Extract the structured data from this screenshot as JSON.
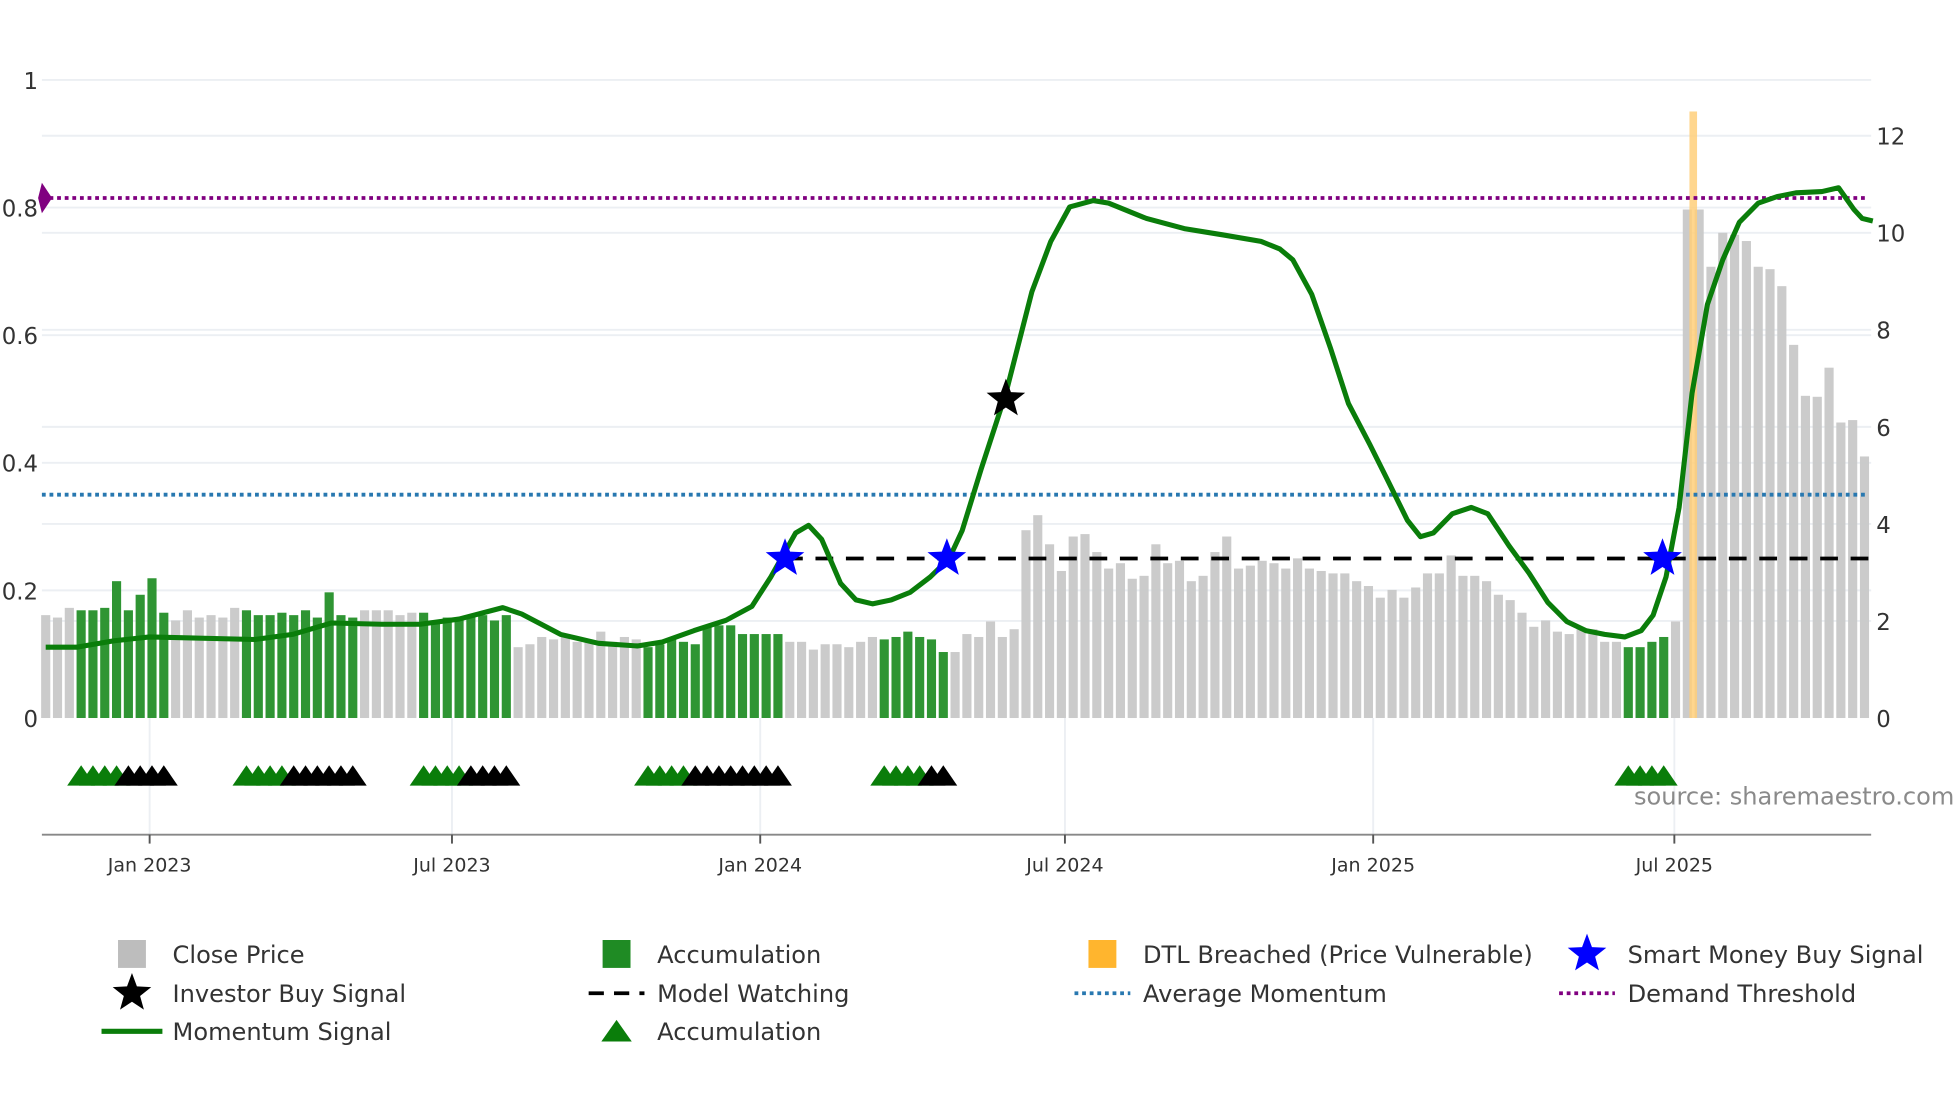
{
  "chart_data": {
    "type": "bar",
    "x_unit": "weeks since first bar (weekly bars)",
    "left_axis": {
      "ylim": [
        0,
        1
      ],
      "ticks": [
        "0",
        "0.2",
        "0.4",
        "0.6",
        "0.8",
        "1"
      ],
      "tick_values": [
        0,
        0.2,
        0.4,
        0.6,
        0.8,
        1
      ]
    },
    "right_axis": {
      "ylim": [
        0,
        13.15
      ],
      "ticks": [
        "0",
        "2",
        "4",
        "6",
        "8",
        "10",
        "12"
      ],
      "tick_values": [
        0,
        2,
        4,
        6,
        8,
        10,
        12
      ]
    },
    "x_ticks": [
      {
        "label": "Jan 2023",
        "x": 8.8
      },
      {
        "label": "Jul 2023",
        "x": 34.4
      },
      {
        "label": "Jan 2024",
        "x": 60.5
      },
      {
        "label": "Jul 2024",
        "x": 86.3
      },
      {
        "label": "Jan 2025",
        "x": 112.4
      },
      {
        "label": "Jul 2025",
        "x": 137.9
      }
    ],
    "close_price": [
      2.12,
      2.07,
      2.27,
      2.22,
      2.22,
      2.27,
      2.82,
      2.22,
      2.54,
      2.88,
      2.17,
      2.01,
      2.22,
      2.07,
      2.12,
      2.07,
      2.27,
      2.22,
      2.12,
      2.12,
      2.17,
      2.12,
      2.22,
      2.07,
      2.59,
      2.12,
      2.07,
      2.22,
      2.22,
      2.22,
      2.12,
      2.17,
      2.17,
      2.01,
      2.07,
      2.07,
      2.12,
      2.12,
      2.01,
      2.12,
      1.46,
      1.52,
      1.67,
      1.62,
      1.67,
      1.57,
      1.62,
      1.78,
      1.57,
      1.67,
      1.62,
      1.46,
      1.52,
      1.62,
      1.57,
      1.52,
      1.88,
      1.91,
      1.91,
      1.73,
      1.73,
      1.73,
      1.73,
      1.57,
      1.57,
      1.41,
      1.52,
      1.52,
      1.46,
      1.57,
      1.67,
      1.62,
      1.67,
      1.78,
      1.67,
      1.62,
      1.36,
      1.36,
      1.73,
      1.67,
      1.99,
      1.67,
      1.83,
      3.87,
      4.18,
      3.58,
      3.03,
      3.74,
      3.79,
      3.42,
      3.08,
      3.19,
      2.87,
      2.93,
      3.58,
      3.19,
      3.24,
      2.82,
      2.93,
      3.42,
      3.74,
      3.08,
      3.14,
      3.24,
      3.19,
      3.08,
      3.29,
      3.08,
      3.03,
      2.98,
      2.98,
      2.82,
      2.72,
      2.48,
      2.64,
      2.48,
      2.69,
      2.98,
      2.98,
      3.35,
      2.93,
      2.93,
      2.82,
      2.54,
      2.43,
      2.17,
      1.88,
      2.01,
      1.78,
      1.73,
      1.83,
      1.83,
      1.57,
      1.57,
      1.46,
      1.46,
      1.57,
      1.67,
      1.99,
      10.48,
      10.48,
      9.3,
      10.0,
      9.96,
      9.83,
      9.3,
      9.25,
      8.9,
      7.69,
      6.64,
      6.62,
      7.22,
      6.09,
      6.14,
      5.39
    ],
    "accumulation_ranges": [
      [
        3,
        10
      ],
      [
        17,
        26
      ],
      [
        32,
        39
      ],
      [
        51,
        62
      ],
      [
        71,
        76
      ],
      [
        134,
        137
      ]
    ],
    "dtl_breached": {
      "x": 139.5,
      "value": 12.5
    },
    "momentum_signal": [
      [
        0,
        0.111
      ],
      [
        2.6,
        0.111
      ],
      [
        5.8,
        0.121
      ],
      [
        8.8,
        0.127
      ],
      [
        17.7,
        0.123
      ],
      [
        20.9,
        0.131
      ],
      [
        24.2,
        0.149
      ],
      [
        28.5,
        0.147
      ],
      [
        31.7,
        0.147
      ],
      [
        35.0,
        0.155
      ],
      [
        38.7,
        0.173
      ],
      [
        40.3,
        0.163
      ],
      [
        43.6,
        0.131
      ],
      [
        46.8,
        0.117
      ],
      [
        50.1,
        0.113
      ],
      [
        52.2,
        0.119
      ],
      [
        54.9,
        0.137
      ],
      [
        57.6,
        0.153
      ],
      [
        59.8,
        0.175
      ],
      [
        61.4,
        0.221
      ],
      [
        63.5,
        0.29
      ],
      [
        64.6,
        0.302
      ],
      [
        65.7,
        0.28
      ],
      [
        67.3,
        0.211
      ],
      [
        68.6,
        0.185
      ],
      [
        70.0,
        0.179
      ],
      [
        71.6,
        0.185
      ],
      [
        73.2,
        0.197
      ],
      [
        74.9,
        0.221
      ],
      [
        76.5,
        0.25
      ],
      [
        77.6,
        0.294
      ],
      [
        79.2,
        0.39
      ],
      [
        81.3,
        0.509
      ],
      [
        83.5,
        0.668
      ],
      [
        85.1,
        0.747
      ],
      [
        86.7,
        0.801
      ],
      [
        88.7,
        0.811
      ],
      [
        90.0,
        0.807
      ],
      [
        93.2,
        0.783
      ],
      [
        96.4,
        0.767
      ],
      [
        99.7,
        0.757
      ],
      [
        102.9,
        0.747
      ],
      [
        104.5,
        0.735
      ],
      [
        105.6,
        0.718
      ],
      [
        107.2,
        0.664
      ],
      [
        108.8,
        0.579
      ],
      [
        110.3,
        0.493
      ],
      [
        112.1,
        0.429
      ],
      [
        113.7,
        0.37
      ],
      [
        115.3,
        0.31
      ],
      [
        116.4,
        0.284
      ],
      [
        117.5,
        0.29
      ],
      [
        119.1,
        0.32
      ],
      [
        120.7,
        0.33
      ],
      [
        122.1,
        0.32
      ],
      [
        123.9,
        0.27
      ],
      [
        125.6,
        0.227
      ],
      [
        127.2,
        0.181
      ],
      [
        128.8,
        0.151
      ],
      [
        130.4,
        0.137
      ],
      [
        132.0,
        0.131
      ],
      [
        133.7,
        0.127
      ],
      [
        135.1,
        0.137
      ],
      [
        136.1,
        0.161
      ],
      [
        137.2,
        0.221
      ],
      [
        138.3,
        0.33
      ],
      [
        139.4,
        0.509
      ],
      [
        140.7,
        0.648
      ],
      [
        142.0,
        0.718
      ],
      [
        143.4,
        0.777
      ],
      [
        145.0,
        0.807
      ],
      [
        146.6,
        0.817
      ],
      [
        148.2,
        0.823
      ],
      [
        150.4,
        0.825
      ],
      [
        151.8,
        0.831
      ],
      [
        153.1,
        0.797
      ],
      [
        153.8,
        0.783
      ],
      [
        154.7,
        0.779
      ]
    ],
    "smart_money_buy_signals": [
      [
        62.6,
        0.25
      ],
      [
        76.3,
        0.25
      ],
      [
        136.9,
        0.25
      ]
    ],
    "investor_buy_signals": [
      [
        81.3,
        0.5
      ]
    ],
    "model_watching": {
      "from": 62.6,
      "to": 154.7,
      "value": 0.25
    },
    "average_momentum": 0.35,
    "demand_threshold": 0.815,
    "accumulation_markers": {
      "value": -0.09,
      "green_per_run": 4
    },
    "source": "source: sharemaestro.com",
    "legend": [
      {
        "label": "Close Price",
        "symbol": "square",
        "color": "#bdbdbd"
      },
      {
        "label": "Accumulation",
        "symbol": "square",
        "color": "#1f8b24"
      },
      {
        "label": "DTL Breached (Price Vulnerable)",
        "symbol": "square",
        "color": "#ffb52e"
      },
      {
        "label": "Smart Money Buy Signal",
        "symbol": "star",
        "color": "#0000ff"
      },
      {
        "label": "Investor Buy Signal",
        "symbol": "star",
        "color": "#000000"
      },
      {
        "label": "Model Watching",
        "symbol": "dash",
        "color": "#000000"
      },
      {
        "label": "Average Momentum",
        "symbol": "dot",
        "color": "#2878b0"
      },
      {
        "label": "Demand Threshold",
        "symbol": "dot",
        "color": "#800080"
      },
      {
        "label": "Momentum Signal",
        "symbol": "line",
        "color": "#0a7d0a"
      },
      {
        "label": "Accumulation",
        "symbol": "triangle",
        "color": "#0a7d0a"
      }
    ],
    "colors": {
      "close": "#c8c8c8",
      "accum_bar": "#2f9533",
      "line": "#0a7d0a",
      "dtl": "#ffcf7a",
      "smart": "#0000ff",
      "investor": "#000000",
      "avg": "#2878b0",
      "threshold": "#800080",
      "grid": "#eceff3",
      "axis": "#888888"
    }
  }
}
